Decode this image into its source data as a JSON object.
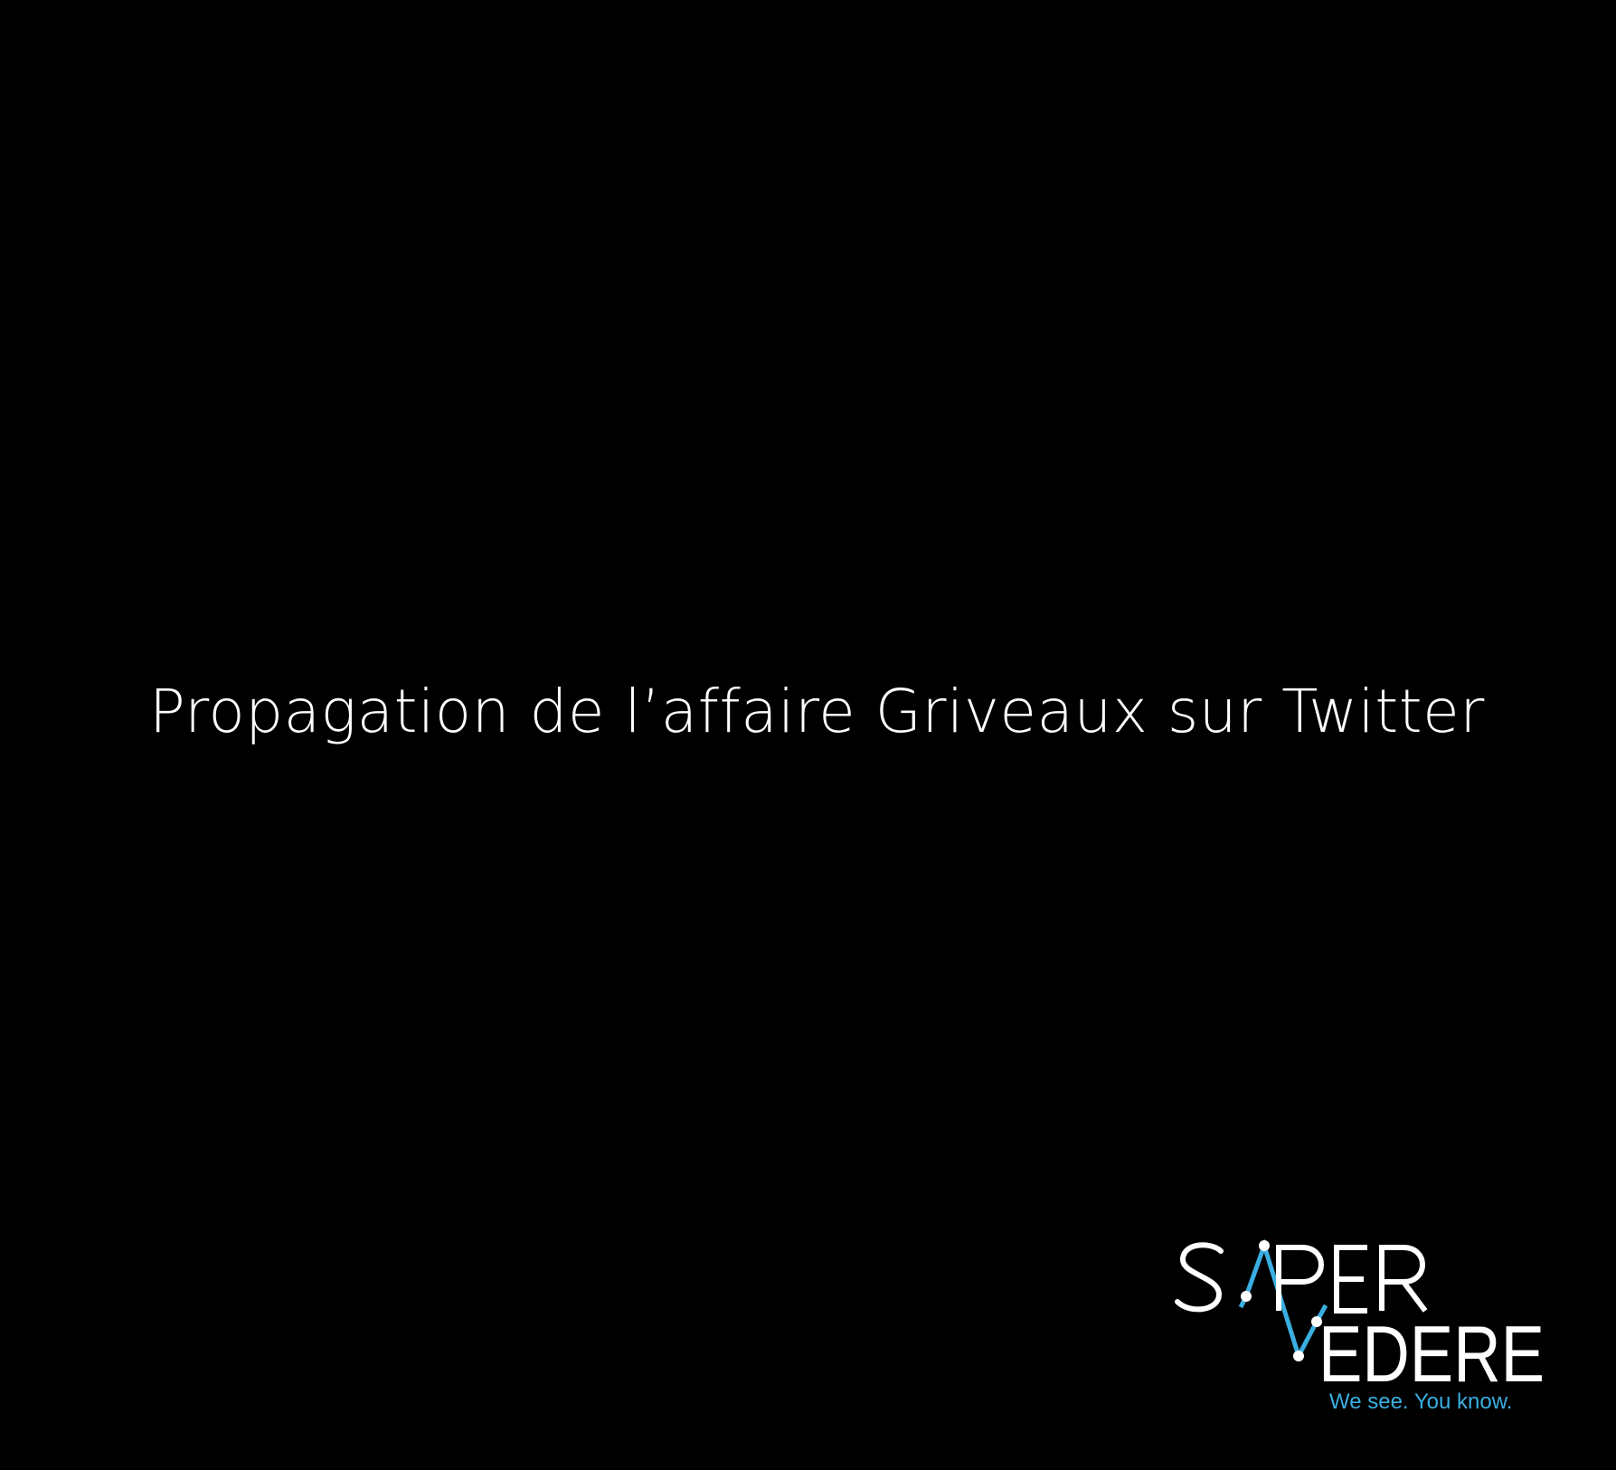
{
  "slide": {
    "background_color": "#000000",
    "title": "Propagation de l’affaire Griveaux sur Twitter"
  },
  "logo": {
    "line1": "SAPER",
    "line2": "VEDERE",
    "tagline": "We see. You know.",
    "primary_color": "#ffffff",
    "accent_color": "#3aaee0"
  }
}
